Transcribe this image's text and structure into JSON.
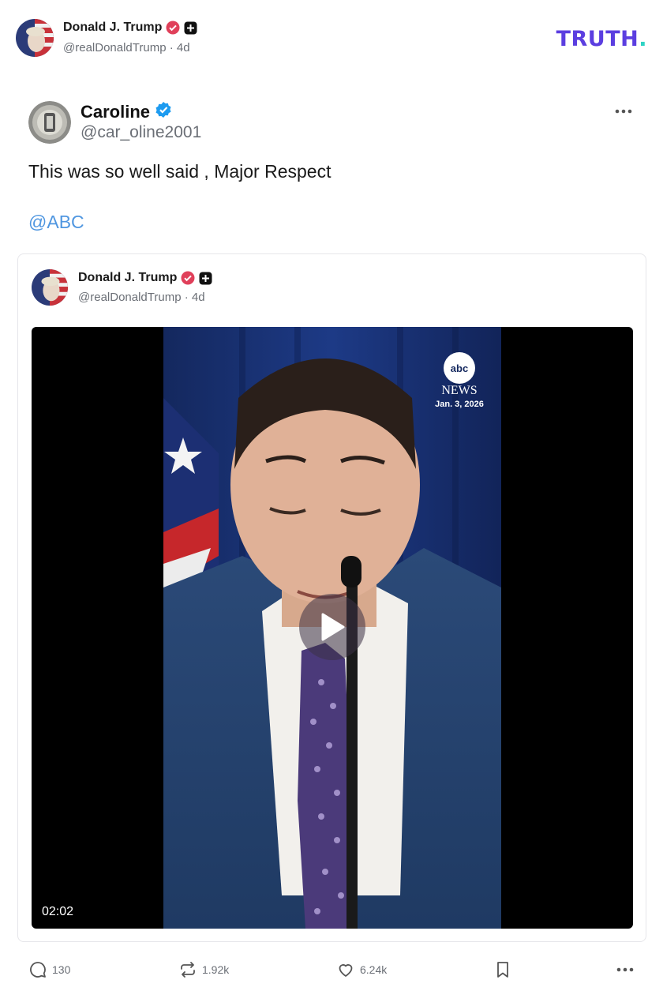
{
  "header": {
    "name": "Donald J. Trump",
    "handle": "@realDonaldTrump",
    "time": "4d",
    "logo_text": "TRUTH",
    "logo_dot": "."
  },
  "post": {
    "name": "Caroline",
    "handle": "@car_oline2001",
    "text": "This was so well said , Major Respect",
    "mention": "@ABC"
  },
  "quote": {
    "name": "Donald J. Trump",
    "handle": "@realDonaldTrump",
    "time": "4d",
    "video": {
      "duration": "02:02",
      "overlay_brand": "abc",
      "overlay_news": "NEWS",
      "overlay_date": "Jan. 3, 2026"
    }
  },
  "actions": {
    "replies": "130",
    "retruths": "1.92k",
    "likes": "6.24k"
  },
  "colors": {
    "brand_purple": "#5b3ee0",
    "brand_teal": "#2fd3c4",
    "link_blue": "#4f96e0",
    "verified_red": "#e0405a",
    "verified_blue": "#1d9bf0"
  },
  "icons": {
    "verified_red": "verified-badge-icon",
    "plus_badge": "plus-badge-icon",
    "verified_blue": "verified-check-icon",
    "more": "ellipsis-icon",
    "reply": "comment-icon",
    "retruth": "repost-icon",
    "like": "heart-icon",
    "bookmark": "bookmark-icon",
    "play": "play-icon"
  }
}
